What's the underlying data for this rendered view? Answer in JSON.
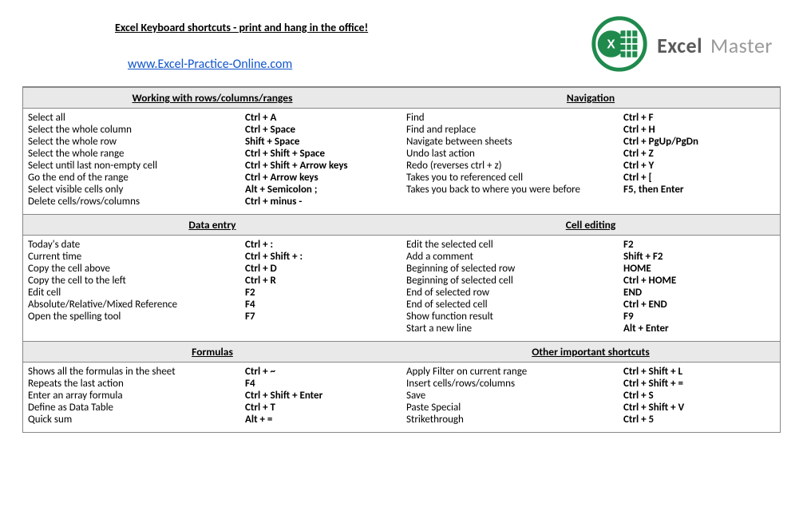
{
  "header": {
    "title": "Excel Keyboard shortcuts - print and hang in the office!",
    "link": "www.Excel-Practice-Online.com",
    "brand_bold": "Excel",
    "brand_light": "Master"
  },
  "sections": {
    "working": {
      "title": "Working with rows/columns/ranges",
      "items": [
        {
          "d": "Select all",
          "k": "Ctrl + A"
        },
        {
          "d": "Select the whole column",
          "k": "Ctrl + Space"
        },
        {
          "d": "Select the whole row",
          "k": "Shift + Space"
        },
        {
          "d": "Select the whole range",
          "k": "Ctrl + Shift + Space"
        },
        {
          "d": "Select until last non-empty cell",
          "k": "Ctrl + Shift + Arrow keys"
        },
        {
          "d": "Go the end of the range",
          "k": "Ctrl + Arrow keys"
        },
        {
          "d": "Select visible cells only",
          "k": "Alt + Semicolon ;"
        },
        {
          "d": "Delete cells/rows/columns",
          "k": "Ctrl + minus -"
        }
      ]
    },
    "navigation": {
      "title": "Navigation",
      "items": [
        {
          "d": "Find",
          "k": "Ctrl + F"
        },
        {
          "d": "Find and replace",
          "k": "Ctrl + H"
        },
        {
          "d": "Navigate between sheets",
          "k": "Ctrl + PgUp/PgDn"
        },
        {
          "d": "Undo last action",
          "k": "Ctrl + Z"
        },
        {
          "d": "Redo (reverses ctrl + z)",
          "k": "Ctrl + Y"
        },
        {
          "d": "Takes you to referenced cell",
          "k": "Ctrl + ["
        },
        {
          "d": "Takes you back to where you were before",
          "k": "F5, then Enter"
        }
      ]
    },
    "dataentry": {
      "title": "Data entry",
      "items": [
        {
          "d": "Today's date",
          "k": "Ctrl + :"
        },
        {
          "d": "Current time",
          "k": "Ctrl + Shift + :"
        },
        {
          "d": "Copy the cell above",
          "k": "Ctrl + D"
        },
        {
          "d": "Copy the cell to the left",
          "k": "Ctrl + R"
        },
        {
          "d": "Edit cell",
          "k": "F2"
        },
        {
          "d": "Absolute/Relative/Mixed Reference",
          "k": "F4"
        },
        {
          "d": "Open the spelling tool",
          "k": "F7"
        }
      ]
    },
    "cellediting": {
      "title": "Cell editing",
      "items": [
        {
          "d": "Edit the selected cell",
          "k": "F2"
        },
        {
          "d": "Add a comment",
          "k": "Shift + F2"
        },
        {
          "d": "Beginning of selected row",
          "k": "HOME"
        },
        {
          "d": "Beginning of selected cell",
          "k": "Ctrl + HOME"
        },
        {
          "d": "End of selected row",
          "k": "END"
        },
        {
          "d": "End of selected cell",
          "k": "Ctrl + END"
        },
        {
          "d": "Show function result",
          "k": "F9"
        },
        {
          "d": "Start a new line",
          "k": "Alt + Enter"
        }
      ]
    },
    "formulas": {
      "title": "Formulas",
      "items": [
        {
          "d": "Shows all the formulas in the sheet",
          "k": "Ctrl + ~"
        },
        {
          "d": "Repeats the last action",
          "k": "F4"
        },
        {
          "d": "Enter an array formula",
          "k": "Ctrl + Shift + Enter"
        },
        {
          "d": "Define as Data Table",
          "k": "Ctrl + T"
        },
        {
          "d": "Quick sum",
          "k": "Alt + ="
        }
      ]
    },
    "other": {
      "title": "Other important shortcuts",
      "items": [
        {
          "d": "Apply Filter on current range",
          "k": "Ctrl + Shift + L"
        },
        {
          "d": "Insert cells/rows/columns",
          "k": "Ctrl + Shift + ="
        },
        {
          "d": "Save",
          "k": "Ctrl + S"
        },
        {
          "d": "Paste Special",
          "k": "Ctrl + Shift + V"
        },
        {
          "d": "Strikethrough",
          "k": "Ctrl + 5"
        }
      ]
    }
  }
}
